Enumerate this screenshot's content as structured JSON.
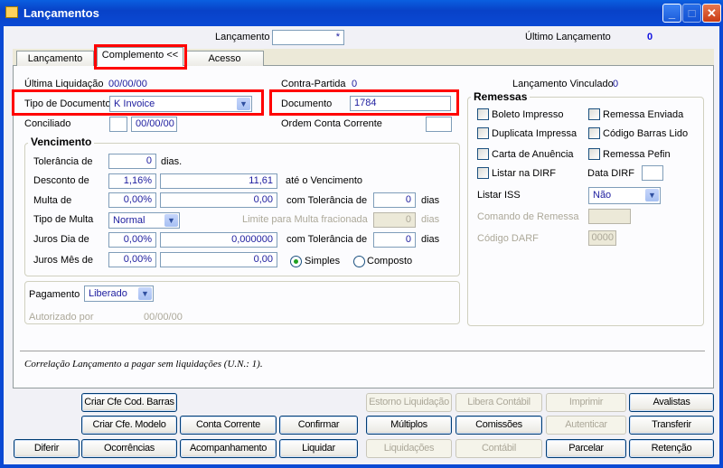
{
  "window": {
    "title": "Lançamentos",
    "minimize": "_",
    "maximize": "□",
    "close": "✕"
  },
  "header": {
    "lancamento_label": "Lançamento",
    "lancamento_value": "*",
    "ultimo_label": "Último Lançamento",
    "ultimo_value": "0"
  },
  "tabs": [
    {
      "label": "Lançamento"
    },
    {
      "label": "Complemento <<"
    },
    {
      "label": "Acesso"
    }
  ],
  "form": {
    "ultima_liquidacao_label": "Última Liquidação",
    "ultima_liquidacao_value": "00/00/00",
    "contra_partida_label": "Contra-Partida",
    "contra_partida_value": "0",
    "lancamento_vinculado_label": "Lançamento Vinculado",
    "lancamento_vinculado_value": "0",
    "tipo_documento_label": "Tipo de Documento",
    "tipo_documento_value": "K Invoice",
    "documento_label": "Documento",
    "documento_value": "1784",
    "conciliado_label": "Conciliado",
    "conciliado_date": "00/00/00",
    "ordem_conta_label": "Ordem Conta Corrente"
  },
  "vencimento": {
    "title": "Vencimento",
    "tolerancia_label": "Tolerância de",
    "tolerancia_value": "0",
    "dias_dot": "dias.",
    "desconto_label": "Desconto de",
    "desconto_pct": "1,16%",
    "desconto_value": "11,61",
    "ate_label": "até o Vencimento",
    "multa_label": "Multa de",
    "multa_pct": "0,00%",
    "multa_value": "0,00",
    "com_tol_label": "com Tolerância de",
    "multa_tol": "0",
    "dias": "dias",
    "tipo_multa_label": "Tipo de Multa",
    "tipo_multa_value": "Normal",
    "limite_label": "Limite para Multa fracionada",
    "limite_value": "0",
    "juros_dia_label": "Juros Dia de",
    "juros_dia_pct": "0,00%",
    "juros_dia_value": "0,000000",
    "juros_tol": "0",
    "juros_mes_label": "Juros Mês de",
    "juros_mes_pct": "0,00%",
    "juros_mes_value": "0,00",
    "simples": "Simples",
    "composto": "Composto"
  },
  "pagamento": {
    "label": "Pagamento",
    "value": "Liberado",
    "autorizado_label": "Autorizado por",
    "autorizado_date": "00/00/00"
  },
  "remessas": {
    "title": "Remessas",
    "checks": [
      "Boleto Impresso",
      "Remessa Enviada",
      "Duplicata Impressa",
      "Código Barras Lido",
      "Carta de Anuência",
      "Remessa Pefin",
      "Listar na DIRF"
    ],
    "data_dirf_label": "Data DIRF",
    "listar_iss_label": "Listar ISS",
    "listar_iss_value": "Não",
    "comando_label": "Comando de Remessa",
    "darf_label": "Código DARF",
    "darf_value": "0000"
  },
  "status": "Correlação  Lançamento a pagar sem liquidações (U.N.: 1).",
  "buttons": [
    {
      "label": "Criar Cfe Cod. Barras",
      "row": 0,
      "col": 1,
      "enabled": true
    },
    {
      "label": "Estorno Liquidação",
      "row": 0,
      "col": 4,
      "enabled": false
    },
    {
      "label": "Libera Contábil",
      "row": 0,
      "col": 5,
      "enabled": false
    },
    {
      "label": "Imprimir",
      "row": 0,
      "col": 6,
      "enabled": false
    },
    {
      "label": "Avalistas",
      "row": 0,
      "col": 7,
      "enabled": true
    },
    {
      "label": "Criar Cfe. Modelo",
      "row": 1,
      "col": 1,
      "enabled": true
    },
    {
      "label": "Conta Corrente",
      "row": 1,
      "col": 2,
      "enabled": true
    },
    {
      "label": "Confirmar",
      "row": 1,
      "col": 3,
      "enabled": true
    },
    {
      "label": "Múltiplos",
      "row": 1,
      "col": 4,
      "enabled": true
    },
    {
      "label": "Comissões",
      "row": 1,
      "col": 5,
      "enabled": true
    },
    {
      "label": "Autenticar",
      "row": 1,
      "col": 6,
      "enabled": false
    },
    {
      "label": "Transferir",
      "row": 1,
      "col": 7,
      "enabled": true
    },
    {
      "label": "Diferir",
      "row": 2,
      "col": 0,
      "enabled": true
    },
    {
      "label": "Ocorrências",
      "row": 2,
      "col": 1,
      "enabled": true
    },
    {
      "label": "Acompanhamento",
      "row": 2,
      "col": 2,
      "enabled": true
    },
    {
      "label": "Liquidar",
      "row": 2,
      "col": 3,
      "enabled": true
    },
    {
      "label": "Liquidações",
      "row": 2,
      "col": 4,
      "enabled": false
    },
    {
      "label": "Contábil",
      "row": 2,
      "col": 5,
      "enabled": false
    },
    {
      "label": "Parcelar",
      "row": 2,
      "col": 6,
      "enabled": true
    },
    {
      "label": "Retenção",
      "row": 2,
      "col": 7,
      "enabled": true
    }
  ]
}
